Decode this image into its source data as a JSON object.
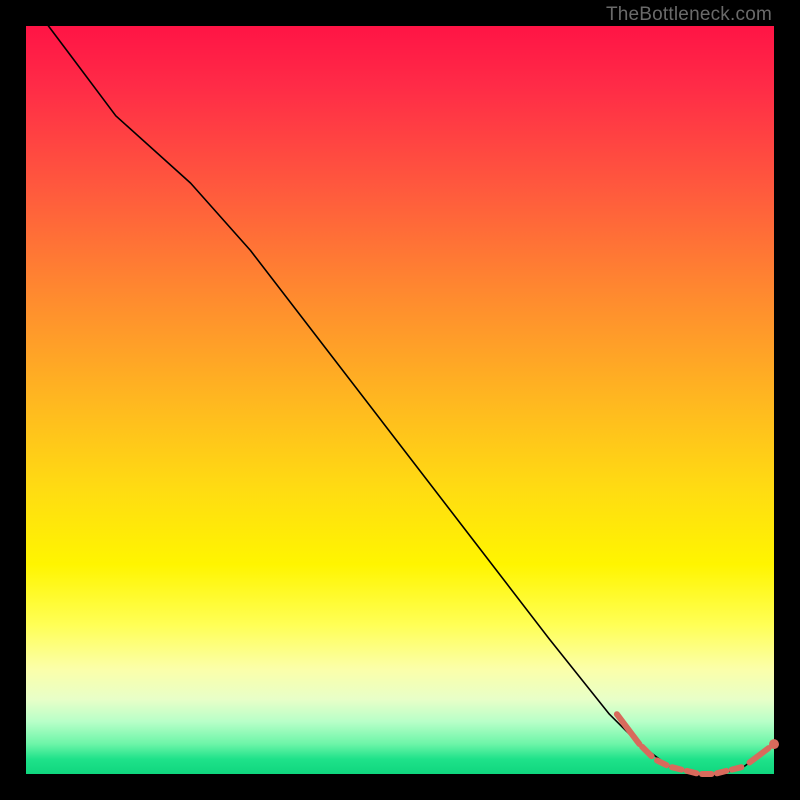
{
  "watermark": "TheBottleneck.com",
  "colors": {
    "background": "#000000",
    "curve": "#000000",
    "marker": "#d86a5c",
    "gradient_top": "#ff1445",
    "gradient_mid": "#fff500",
    "gradient_bottom": "#0fd67e"
  },
  "chart_data": {
    "type": "line",
    "title": "",
    "xlabel": "",
    "ylabel": "",
    "xlim": [
      0,
      100
    ],
    "ylim": [
      0,
      100
    ],
    "grid": false,
    "legend": false,
    "series": [
      {
        "name": "bottleneck-curve",
        "x": [
          0,
          6,
          12,
          22,
          30,
          40,
          50,
          60,
          70,
          78,
          82,
          86,
          90,
          93,
          96,
          100
        ],
        "values": [
          104,
          96,
          88,
          79,
          70,
          57,
          44,
          31,
          18,
          8,
          4,
          1,
          0,
          0,
          1,
          4
        ]
      }
    ],
    "markers": {
      "comment": "salmon dashed segment near minimum, approximate x positions and shared y≈0–4",
      "points_x": [
        82,
        84,
        86,
        88,
        90,
        92,
        94,
        96,
        100
      ],
      "points_y": [
        4,
        2,
        1,
        0.5,
        0,
        0,
        0.5,
        1,
        4
      ]
    }
  }
}
